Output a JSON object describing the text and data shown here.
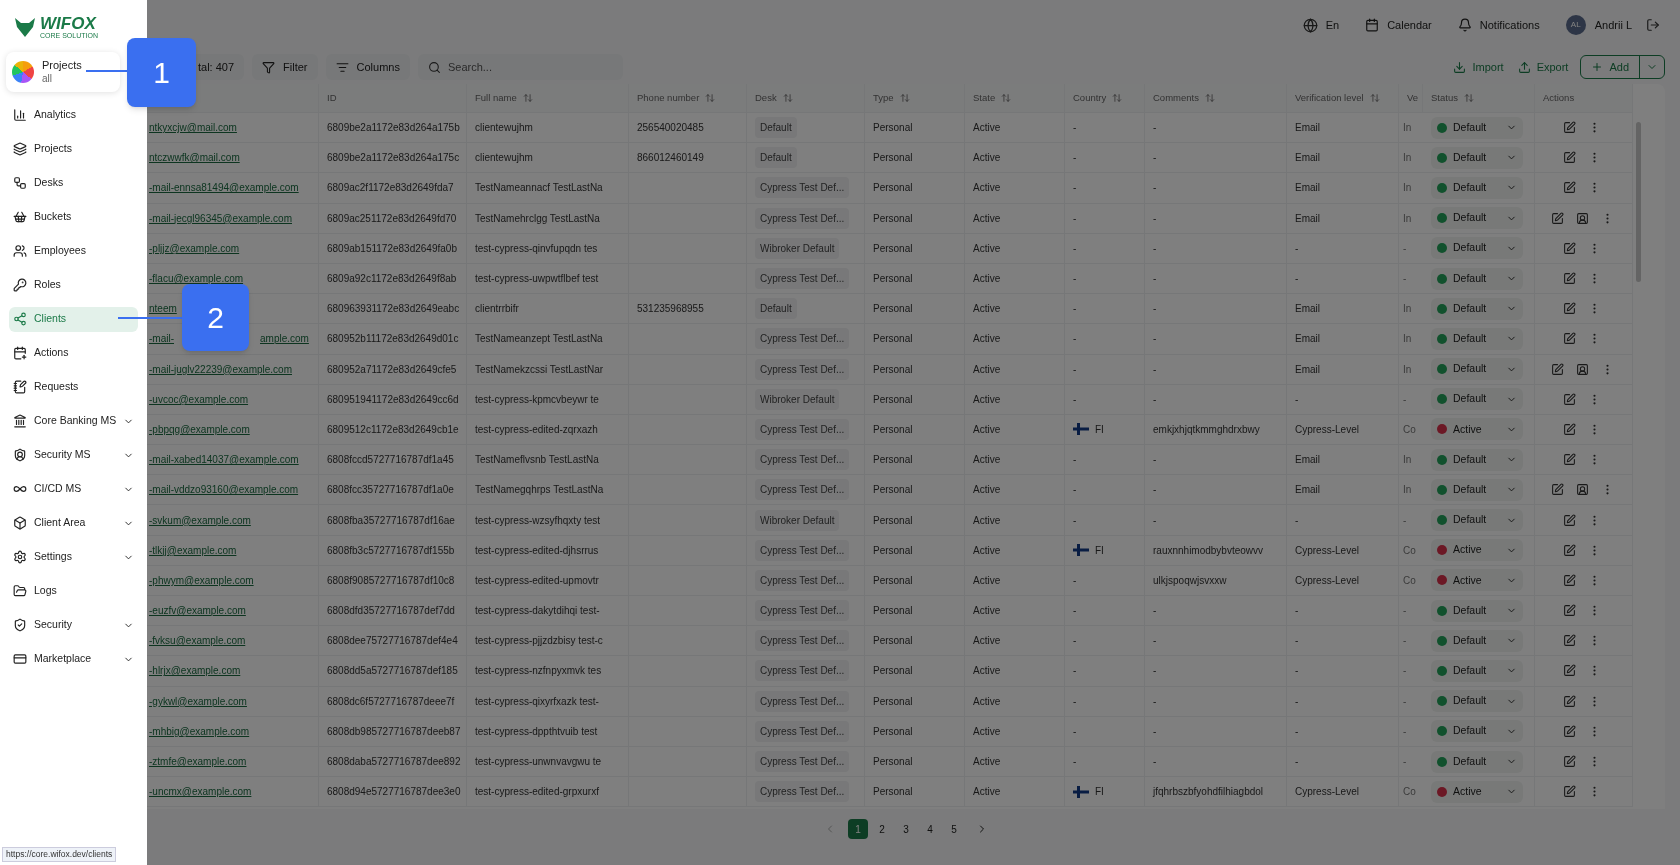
{
  "logo": {
    "name": "WIFOX",
    "tagline": "CORE SOLUTION"
  },
  "project_switcher": {
    "label": "Projects",
    "value": "all"
  },
  "sidebar": {
    "items": [
      {
        "label": "Analytics",
        "selected": false,
        "expandable": false
      },
      {
        "label": "Projects",
        "selected": false,
        "expandable": false
      },
      {
        "label": "Desks",
        "selected": false,
        "expandable": false
      },
      {
        "label": "Buckets",
        "selected": false,
        "expandable": false
      },
      {
        "label": "Employees",
        "selected": false,
        "expandable": false
      },
      {
        "label": "Roles",
        "selected": false,
        "expandable": false
      },
      {
        "label": "Clients",
        "selected": true,
        "expandable": false
      },
      {
        "label": "Actions",
        "selected": false,
        "expandable": false
      },
      {
        "label": "Requests",
        "selected": false,
        "expandable": false
      },
      {
        "label": "Core Banking MS",
        "selected": false,
        "expandable": true
      },
      {
        "label": "Security MS",
        "selected": false,
        "expandable": true
      },
      {
        "label": "CI/CD MS",
        "selected": false,
        "expandable": true
      },
      {
        "label": "Client Area",
        "selected": false,
        "expandable": true
      },
      {
        "label": "Settings",
        "selected": false,
        "expandable": true
      },
      {
        "label": "Logs",
        "selected": false,
        "expandable": false
      },
      {
        "label": "Security",
        "selected": false,
        "expandable": true
      },
      {
        "label": "Marketplace",
        "selected": false,
        "expandable": true
      }
    ]
  },
  "status_url": "https://core.wifox.dev/clients",
  "header": {
    "language": "En",
    "calendar": "Calendar",
    "notifications": "Notifications",
    "user": {
      "initials": "AL",
      "name": "Andrii L"
    }
  },
  "toolbar": {
    "total": "tal: 407",
    "filter": "Filter",
    "columns": "Columns",
    "search_placeholder": "Search...",
    "import": "Import",
    "export": "Export",
    "add": "Add"
  },
  "table": {
    "columns": [
      {
        "label": "ID",
        "sortable": false
      },
      {
        "label": "Full name",
        "sortable": true
      },
      {
        "label": "Phone number",
        "sortable": true
      },
      {
        "label": "Desk",
        "sortable": true
      },
      {
        "label": "Type",
        "sortable": true
      },
      {
        "label": "State",
        "sortable": true
      },
      {
        "label": "Country",
        "sortable": true
      },
      {
        "label": "Comments",
        "sortable": true
      },
      {
        "label": "Verification level",
        "sortable": true
      },
      {
        "label": "Ve",
        "sortable": false
      },
      {
        "label": "Status",
        "sortable": true
      },
      {
        "label": "Actions",
        "sortable": false
      }
    ],
    "rows": [
      {
        "email": "ntkyxcjw@mail.com",
        "id": "6809be2a1172e83d264a175b",
        "full_name": "clientewujhm",
        "phone": "256540020485",
        "desk": "Default",
        "type": "Personal",
        "state": "Active",
        "country": "-",
        "flag": false,
        "comments": "-",
        "verification": "Email",
        "ve": "In",
        "status": {
          "label": "Default",
          "color": "#11512d"
        },
        "extra_action": false
      },
      {
        "email": "ntczwwfk@mail.com",
        "id": "6809be2a1172e83d264a175c",
        "full_name": "clientewujhm",
        "phone": "866012460149",
        "desk": "Default",
        "type": "Personal",
        "state": "Active",
        "country": "-",
        "flag": false,
        "comments": "-",
        "verification": "Email",
        "ve": "In",
        "status": {
          "label": "Default",
          "color": "#11512d"
        },
        "extra_action": false
      },
      {
        "email": "-mail-ennsa81494@example.com",
        "id": "6809ac2f1172e83d2649fda7",
        "full_name": "TestNameannacf TestLastNa",
        "desk": "Cypress Test Def...",
        "type": "Personal",
        "state": "Active",
        "country": "-",
        "flag": false,
        "comments": "-",
        "verification": "Email",
        "ve": "In",
        "status": {
          "label": "Default",
          "color": "#11512d"
        },
        "extra_action": false
      },
      {
        "email": "-mail-jecgl96345@example.com",
        "id": "6809ac251172e83d2649fd70",
        "full_name": "TestNamehrclgg TestLastNa",
        "desk": "Cypress Test Def...",
        "type": "Personal",
        "state": "Active",
        "country": "-",
        "flag": false,
        "comments": "-",
        "verification": "Email",
        "ve": "In",
        "status": {
          "label": "Default",
          "color": "#11512d"
        },
        "extra_action": true
      },
      {
        "email": "-pljjz@example.com",
        "id": "6809ab151172e83d2649fa0b",
        "full_name": "test-cypress-qinvfupqdn tes",
        "desk": "Wibroker Default",
        "type": "Personal",
        "state": "Active",
        "country": "-",
        "flag": false,
        "comments": "-",
        "verification": "-",
        "ve": "-",
        "status": {
          "label": "Default",
          "color": "#11512d"
        },
        "extra_action": false
      },
      {
        "email": "-flacu@example.com",
        "id": "6809a92c1172e83d2649f8ab",
        "full_name": "test-cypress-uwpwtflbef test",
        "desk": "Cypress Test Def...",
        "type": "Personal",
        "state": "Active",
        "country": "-",
        "flag": false,
        "comments": "-",
        "verification": "-",
        "ve": "-",
        "status": {
          "label": "Default",
          "color": "#11512d"
        },
        "extra_action": false
      },
      {
        "email": "nteem",
        "id": "680963931172e83d2649eabc",
        "full_name": "clientrrbifr",
        "phone": "531235968955",
        "desk": "Default",
        "type": "Personal",
        "state": "Active",
        "country": "-",
        "flag": false,
        "comments": "-",
        "verification": "Email",
        "ve": "In",
        "status": {
          "label": "Default",
          "color": "#11512d"
        },
        "extra_action": false
      },
      {
        "email": "-mail-",
        "email_end": "ample.com",
        "id": "680952b11172e83d2649d01c",
        "full_name": "TestNameanzept TestLastNa",
        "desk": "Cypress Test Def...",
        "type": "Personal",
        "state": "Active",
        "country": "-",
        "flag": false,
        "comments": "-",
        "verification": "Email",
        "ve": "In",
        "status": {
          "label": "Default",
          "color": "#11512d"
        },
        "extra_action": false
      },
      {
        "email": "-mail-juglv22239@example.com",
        "id": "680952a71172e83d2649cfe5",
        "full_name": "TestNamekzcssi TestLastNar",
        "desk": "Cypress Test Def...",
        "type": "Personal",
        "state": "Active",
        "country": "-",
        "flag": false,
        "comments": "-",
        "verification": "Email",
        "ve": "In",
        "status": {
          "label": "Default",
          "color": "#11512d"
        },
        "extra_action": true
      },
      {
        "email": "-uvcoc@example.com",
        "id": "680951941172e83d2649cc6d",
        "full_name": "test-cypress-kpmcvbeywr te",
        "desk": "Wibroker Default",
        "type": "Personal",
        "state": "Active",
        "country": "-",
        "flag": false,
        "comments": "-",
        "verification": "-",
        "ve": "-",
        "status": {
          "label": "Default",
          "color": "#11512d"
        },
        "extra_action": false
      },
      {
        "email": "-pbpqg@example.com",
        "id": "6809512c1172e83d2649cb1e",
        "full_name": "test-cypress-edited-zqrxazh",
        "desk": "Cypress Test Def...",
        "type": "Personal",
        "state": "Active",
        "country": "FI",
        "flag": true,
        "comments": "emkjxhjqtkmmghdrxbwy",
        "verification": "Cypress-Level",
        "ve": "Co",
        "status": {
          "label": "Active",
          "color": "#6c1825"
        },
        "extra_action": false
      },
      {
        "email": "-mail-xabed14037@example.com",
        "id": "6808fccd5727716787df1a45",
        "full_name": "TestNameflvsnb TestLastNa",
        "desk": "Cypress Test Def...",
        "type": "Personal",
        "state": "Active",
        "country": "-",
        "flag": false,
        "comments": "-",
        "verification": "Email",
        "ve": "In",
        "status": {
          "label": "Default",
          "color": "#11512d"
        },
        "extra_action": false
      },
      {
        "email": "-mail-vddzo93160@example.com",
        "id": "6808fcc35727716787df1a0e",
        "full_name": "TestNamegqhrps TestLastNa",
        "desk": "Cypress Test Def...",
        "type": "Personal",
        "state": "Active",
        "country": "-",
        "flag": false,
        "comments": "-",
        "verification": "Email",
        "ve": "In",
        "status": {
          "label": "Default",
          "color": "#11512d"
        },
        "extra_action": true
      },
      {
        "email": "-svkum@example.com",
        "id": "6808fba35727716787df16ae",
        "full_name": "test-cypress-wzsyfhqxty test",
        "desk": "Wibroker Default",
        "type": "Personal",
        "state": "Active",
        "country": "-",
        "flag": false,
        "comments": "-",
        "verification": "-",
        "ve": "-",
        "status": {
          "label": "Default",
          "color": "#11512d"
        },
        "extra_action": false
      },
      {
        "email": "-tlkjj@example.com",
        "id": "6808fb3c5727716787df155b",
        "full_name": "test-cypress-edited-djhsrrus",
        "desk": "Cypress Test Def...",
        "type": "Personal",
        "state": "Active",
        "country": "FI",
        "flag": true,
        "comments": "rauxnnhimodbybvteowvv",
        "verification": "Cypress-Level",
        "ve": "Co",
        "status": {
          "label": "Active",
          "color": "#6c1825"
        },
        "extra_action": false
      },
      {
        "email": "-phwym@example.com",
        "id": "6808f9085727716787df10c8",
        "full_name": "test-cypress-edited-upmovtr",
        "desk": "Cypress Test Def...",
        "type": "Personal",
        "state": "Active",
        "country": "-",
        "flag": false,
        "comments": "ulkjspoqwjsvxxw",
        "verification": "Cypress-Level",
        "ve": "Co",
        "status": {
          "label": "Active",
          "color": "#6c1825"
        },
        "extra_action": false
      },
      {
        "email": "-euzfv@example.com",
        "id": "6808dfd35727716787def7dd",
        "full_name": "test-cypress-dakytdihqi test-",
        "desk": "Cypress Test Def...",
        "type": "Personal",
        "state": "Active",
        "country": "-",
        "flag": false,
        "comments": "-",
        "verification": "-",
        "ve": "-",
        "status": {
          "label": "Default",
          "color": "#11512d"
        },
        "extra_action": false
      },
      {
        "email": "-fvksu@example.com",
        "id": "6808dee75727716787def4e4",
        "full_name": "test-cypress-pjjzdzbisy test-c",
        "desk": "Cypress Test Def...",
        "type": "Personal",
        "state": "Active",
        "country": "-",
        "flag": false,
        "comments": "-",
        "verification": "-",
        "ve": "-",
        "status": {
          "label": "Default",
          "color": "#11512d"
        },
        "extra_action": false
      },
      {
        "email": "-hlrjx@example.com",
        "id": "6808dd5a5727716787def185",
        "full_name": "test-cypress-nzfnpyxmvk tes",
        "desk": "Cypress Test Def...",
        "type": "Personal",
        "state": "Active",
        "country": "-",
        "flag": false,
        "comments": "-",
        "verification": "-",
        "ve": "-",
        "status": {
          "label": "Default",
          "color": "#11512d"
        },
        "extra_action": false
      },
      {
        "email": "-gykwl@example.com",
        "id": "6808dc6f5727716787deee7f",
        "full_name": "test-cypress-qixyrfxazk test-",
        "desk": "Cypress Test Def...",
        "type": "Personal",
        "state": "Active",
        "country": "-",
        "flag": false,
        "comments": "-",
        "verification": "-",
        "ve": "-",
        "status": {
          "label": "Default",
          "color": "#11512d"
        },
        "extra_action": false
      },
      {
        "email": "-mhbig@example.com",
        "id": "6808db985727716787deeb87",
        "full_name": "test-cypress-dppthtvuib test",
        "desk": "Cypress Test Def...",
        "type": "Personal",
        "state": "Active",
        "country": "-",
        "flag": false,
        "comments": "-",
        "verification": "-",
        "ve": "-",
        "status": {
          "label": "Default",
          "color": "#11512d"
        },
        "extra_action": false
      },
      {
        "email": "-ztmfe@example.com",
        "id": "6808daba5727716787dee892",
        "full_name": "test-cypress-unwnvavgwu te",
        "desk": "Cypress Test Def...",
        "type": "Personal",
        "state": "Active",
        "country": "-",
        "flag": false,
        "comments": "-",
        "verification": "-",
        "ve": "-",
        "status": {
          "label": "Default",
          "color": "#11512d"
        },
        "extra_action": false
      },
      {
        "email": "-uncmx@example.com",
        "id": "6808d94e5727716787dee3e0",
        "full_name": "test-cypress-edited-grpxurxf",
        "desk": "Cypress Test Def...",
        "type": "Personal",
        "state": "Active",
        "country": "FI",
        "flag": true,
        "comments": "jfqhrbszbfyohdfilhiagbdol",
        "verification": "Cypress-Level",
        "ve": "Co",
        "status": {
          "label": "Active",
          "color": "#6c1825"
        },
        "extra_action": false
      }
    ]
  },
  "pagination": {
    "pages": [
      {
        "label": "1",
        "selected": true
      },
      {
        "label": "2",
        "selected": false
      },
      {
        "label": "3",
        "selected": false
      },
      {
        "label": "4",
        "selected": false
      },
      {
        "label": "5",
        "selected": false
      }
    ]
  },
  "callouts": [
    {
      "number": "1"
    },
    {
      "number": "2"
    }
  ]
}
